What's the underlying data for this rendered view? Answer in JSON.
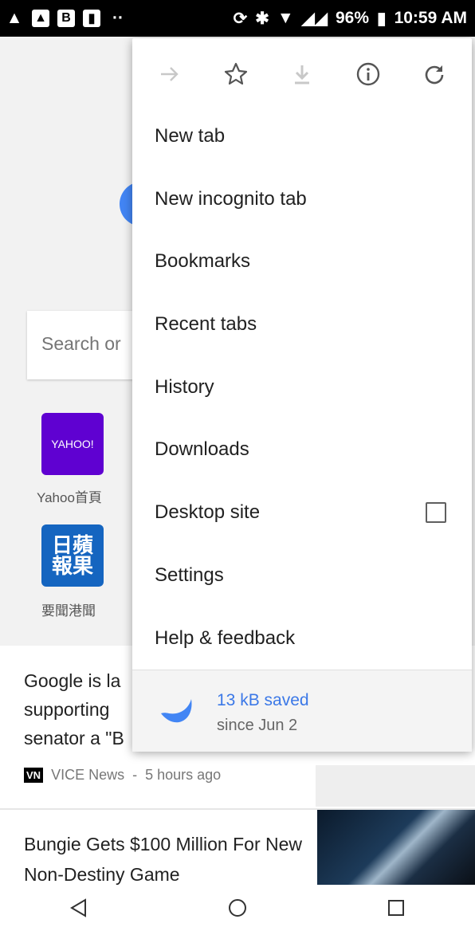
{
  "status_bar": {
    "battery": "96%",
    "time": "10:59 AM"
  },
  "background_page": {
    "search_placeholder": "Search or",
    "tiles": [
      {
        "logo_text": "YAHOO!",
        "label": "Yahoo首頁"
      },
      {
        "logo_text": "日蘋報果",
        "label": "要聞港聞"
      }
    ],
    "articles": [
      {
        "title": "Google is la supporting senator a \"B",
        "source": "VICE News",
        "badge": "VN",
        "time": "5 hours ago"
      },
      {
        "title": "Bungie Gets $100 Million For New Non-Destiny Game"
      }
    ]
  },
  "menu": {
    "icon_row": [
      "forward-icon",
      "star-icon",
      "download-icon",
      "info-icon",
      "refresh-icon"
    ],
    "items": [
      {
        "label": "New tab"
      },
      {
        "label": "New incognito tab"
      },
      {
        "label": "Bookmarks"
      },
      {
        "label": "Recent tabs"
      },
      {
        "label": "History"
      },
      {
        "label": "Downloads"
      },
      {
        "label": "Desktop site",
        "checkbox": false
      },
      {
        "label": "Settings"
      },
      {
        "label": "Help & feedback"
      }
    ],
    "data_saver": {
      "amount": "13 kB saved",
      "since": "since Jun 2"
    }
  },
  "colors": {
    "accent_blue": "#3b78e7",
    "yahoo_purple": "#5f01d1"
  }
}
